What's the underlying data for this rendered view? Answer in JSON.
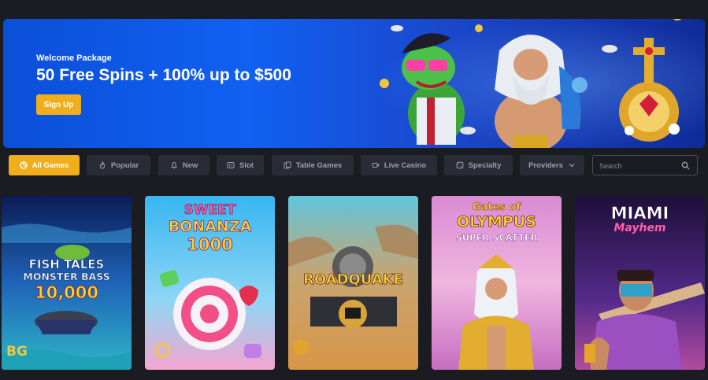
{
  "hero": {
    "eyebrow": "Welcome Package",
    "title": "50 Free Spins + 100% up to $500",
    "cta": "Sign Up"
  },
  "filters": [
    {
      "label": "All Games",
      "icon": "all-games-icon",
      "active": true
    },
    {
      "label": "Popular",
      "icon": "flame-icon",
      "active": false
    },
    {
      "label": "New",
      "icon": "bell-icon",
      "active": false
    },
    {
      "label": "Slot",
      "icon": "slot-machine-icon",
      "active": false
    },
    {
      "label": "Table Games",
      "icon": "cards-icon",
      "active": false
    },
    {
      "label": "Live Casino",
      "icon": "video-camera-icon",
      "active": false
    },
    {
      "label": "Specialty",
      "icon": "dice-icon",
      "active": false
    }
  ],
  "providers": {
    "label": "Providers",
    "icon": "chevron-down-icon"
  },
  "search": {
    "placeholder": "Search",
    "icon": "search-icon"
  },
  "games": [
    {
      "line1": "FISH TALES",
      "line2": "MONSTER BASS",
      "line3": "10,000",
      "provider_mark": "BG"
    },
    {
      "line1": "SWEET",
      "line2": "BONANZA",
      "line3": "1000"
    },
    {
      "line1": "ROADQUAKE"
    },
    {
      "line1": "Gates of",
      "line2": "OLYMPUS",
      "line3": "SUPER SCATTER"
    },
    {
      "line1": "MIAMI",
      "line2": "Mayhem"
    }
  ],
  "colors": {
    "accent": "#f0ae1c",
    "background": "#1b1c22",
    "chip": "#2a2c35",
    "hero_blue": "#1160f2"
  }
}
